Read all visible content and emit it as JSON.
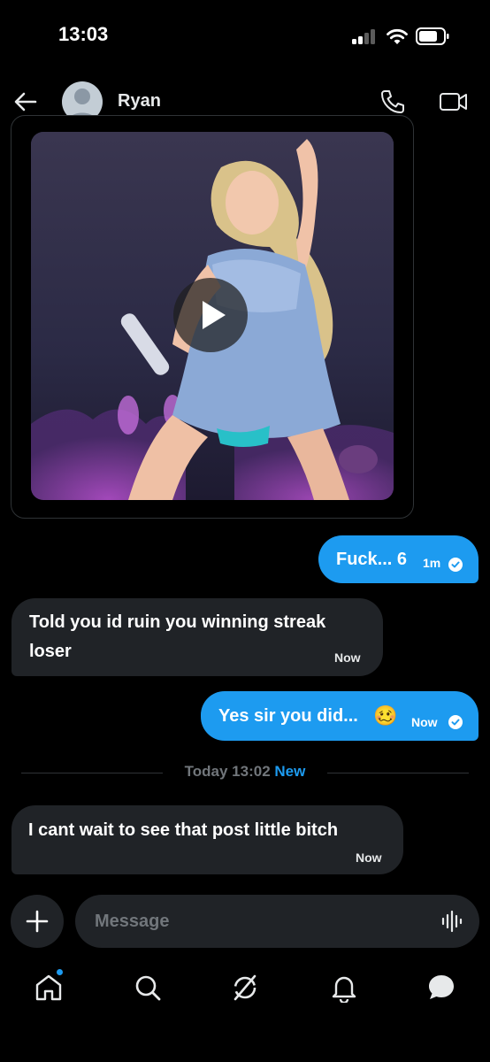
{
  "status_bar": {
    "time": "13:03"
  },
  "header": {
    "contact_name": "Ryan"
  },
  "messages": [
    {
      "direction": "out",
      "text": "Fuck... 6",
      "time": "1m",
      "seen": true
    },
    {
      "direction": "in",
      "text_line1": "Told you id ruin you winning streak",
      "text_line2": "loser",
      "time": "Now"
    },
    {
      "direction": "out",
      "text": "Yes sir you did...",
      "emoji": "🥴",
      "time": "Now",
      "seen": true
    }
  ],
  "divider": {
    "date": "Today 13:02",
    "new_label": "New"
  },
  "last_message": {
    "direction": "in",
    "text": "I cant wait to see that post little bitch",
    "time": "Now"
  },
  "composer": {
    "placeholder": "Message",
    "value": ""
  },
  "nav": {
    "items": [
      "home-icon",
      "search-icon",
      "grok-icon",
      "notifications-icon",
      "messages-icon"
    ],
    "unread_dot_on": "home"
  },
  "colors": {
    "accent": "#1d9bf0",
    "incoming_bubble": "#202327",
    "background": "#000000",
    "muted_text": "#71767b"
  }
}
